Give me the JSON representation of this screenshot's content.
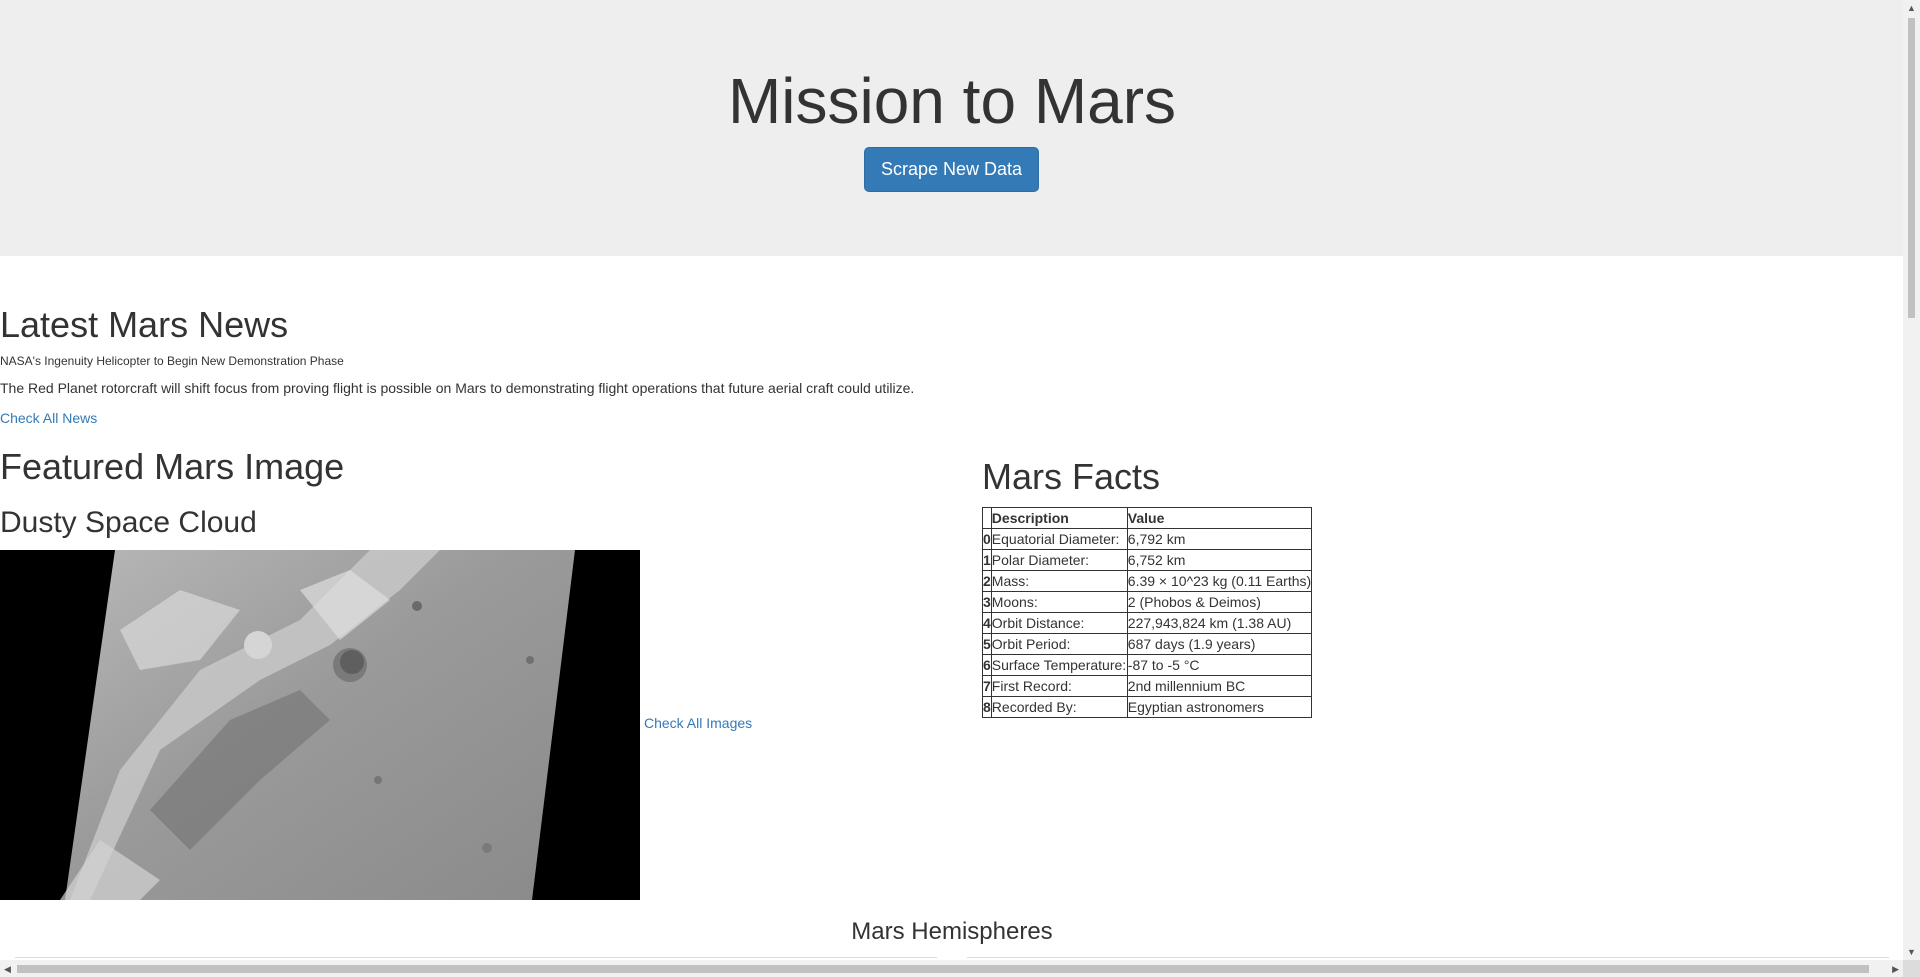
{
  "header": {
    "title": "Mission to Mars",
    "scrape_button": "Scrape New Data"
  },
  "news": {
    "heading": "Latest Mars News",
    "title": "NASA's Ingenuity Helicopter to Begin New Demonstration Phase",
    "paragraph": "The Red Planet rotorcraft will shift focus from proving flight is possible on Mars to demonstrating flight operations that future aerial craft could utilize.",
    "link": "Check All News"
  },
  "featured": {
    "heading": "Featured Mars Image",
    "image_title": "Dusty Space Cloud",
    "link": "Check All Images"
  },
  "facts": {
    "heading": "Mars Facts",
    "columns": [
      "",
      "Description",
      "Value"
    ],
    "rows": [
      {
        "idx": "0",
        "desc": "Equatorial Diameter:",
        "value": "6,792 km"
      },
      {
        "idx": "1",
        "desc": "Polar Diameter:",
        "value": "6,752 km"
      },
      {
        "idx": "2",
        "desc": "Mass:",
        "value": "6.39 × 10^23 kg (0.11 Earths)"
      },
      {
        "idx": "3",
        "desc": "Moons:",
        "value": "2 (Phobos & Deimos)"
      },
      {
        "idx": "4",
        "desc": "Orbit Distance:",
        "value": "227,943,824 km (1.38 AU)"
      },
      {
        "idx": "5",
        "desc": "Orbit Period:",
        "value": "687 days (1.9 years)"
      },
      {
        "idx": "6",
        "desc": "Surface Temperature:",
        "value": "-87 to -5 °C"
      },
      {
        "idx": "7",
        "desc": "First Record:",
        "value": "2nd millennium BC"
      },
      {
        "idx": "8",
        "desc": "Recorded By:",
        "value": "Egyptian astronomers"
      }
    ]
  },
  "hemispheres": {
    "heading": "Mars Hemispheres"
  },
  "colors": {
    "primary": "#337ab7",
    "jumbotron": "#eeeeee",
    "text": "#333333"
  }
}
